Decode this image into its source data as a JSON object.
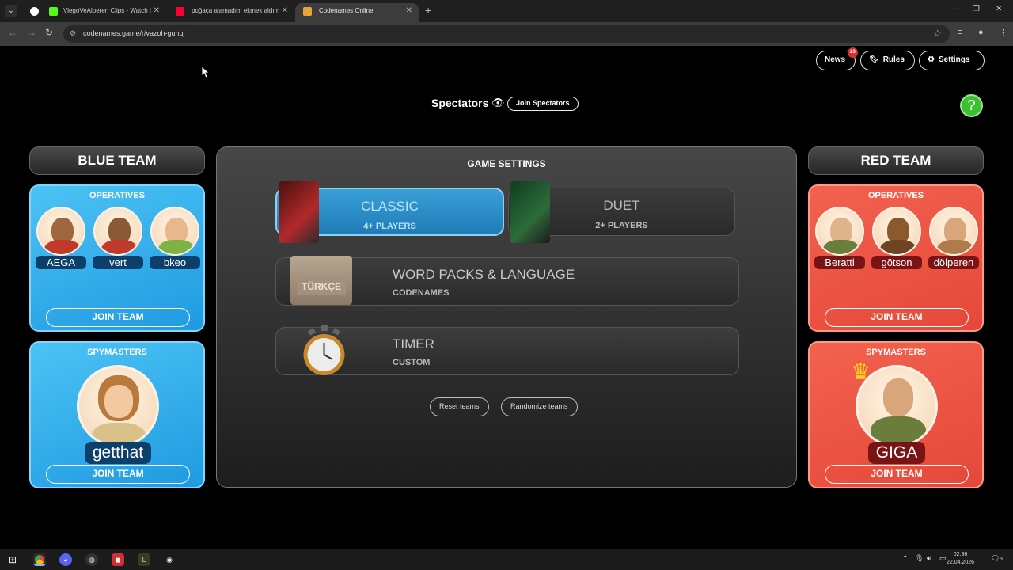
{
  "browser": {
    "tabs": [
      {
        "title": "ViegoVeAlperen Clips - Watch l",
        "favicon_color": "#53fc18"
      },
      {
        "title": "poğaça alamadım ekmek aldım",
        "favicon_color": "#ff0033"
      },
      {
        "title": "Codenames Online",
        "favicon_color": "#e8a33a"
      }
    ],
    "url": "codenames.game/r/vazoh-guhuj"
  },
  "topbar": {
    "news_label": "News",
    "news_count": "23",
    "rules_label": "Rules",
    "settings_label": "Settings"
  },
  "spectators": {
    "label": "Spectators",
    "join_label": "Join Spectators"
  },
  "blue_team": {
    "title": "BLUE TEAM",
    "operatives_title": "OPERATIVES",
    "operatives": [
      "AEGA",
      "vert",
      "bkeo"
    ],
    "spymasters_title": "SPYMASTERS",
    "spymaster": "getthat",
    "join_label": "JOIN TEAM"
  },
  "red_team": {
    "title": "RED TEAM",
    "operatives_title": "OPERATIVES",
    "operatives": [
      "Beratti",
      "götson",
      "dölperen"
    ],
    "spymasters_title": "SPYMASTERS",
    "spymaster": "GIGA",
    "join_label": "JOIN TEAM"
  },
  "game_settings": {
    "title": "GAME SETTINGS",
    "classic": {
      "name": "CLASSIC",
      "players": "4+ PLAYERS"
    },
    "duet": {
      "name": "DUET",
      "players": "2+ PLAYERS"
    },
    "word_packs": {
      "name": "WORD PACKS & LANGUAGE",
      "value": "CODENAMES",
      "pack_label": "TÜRKÇE"
    },
    "timer": {
      "name": "TIMER",
      "value": "CUSTOM"
    },
    "reset_label": "Reset teams",
    "randomize_label": "Randomize teams"
  },
  "taskbar": {
    "time": "02:36",
    "date": "22.04.2026",
    "notifications": "3"
  },
  "colors": {
    "blue_panel": "#2aa7ea",
    "red_panel": "#ea5242",
    "classic_selected": "#2f90c9",
    "help_green": "#3cbf32"
  }
}
